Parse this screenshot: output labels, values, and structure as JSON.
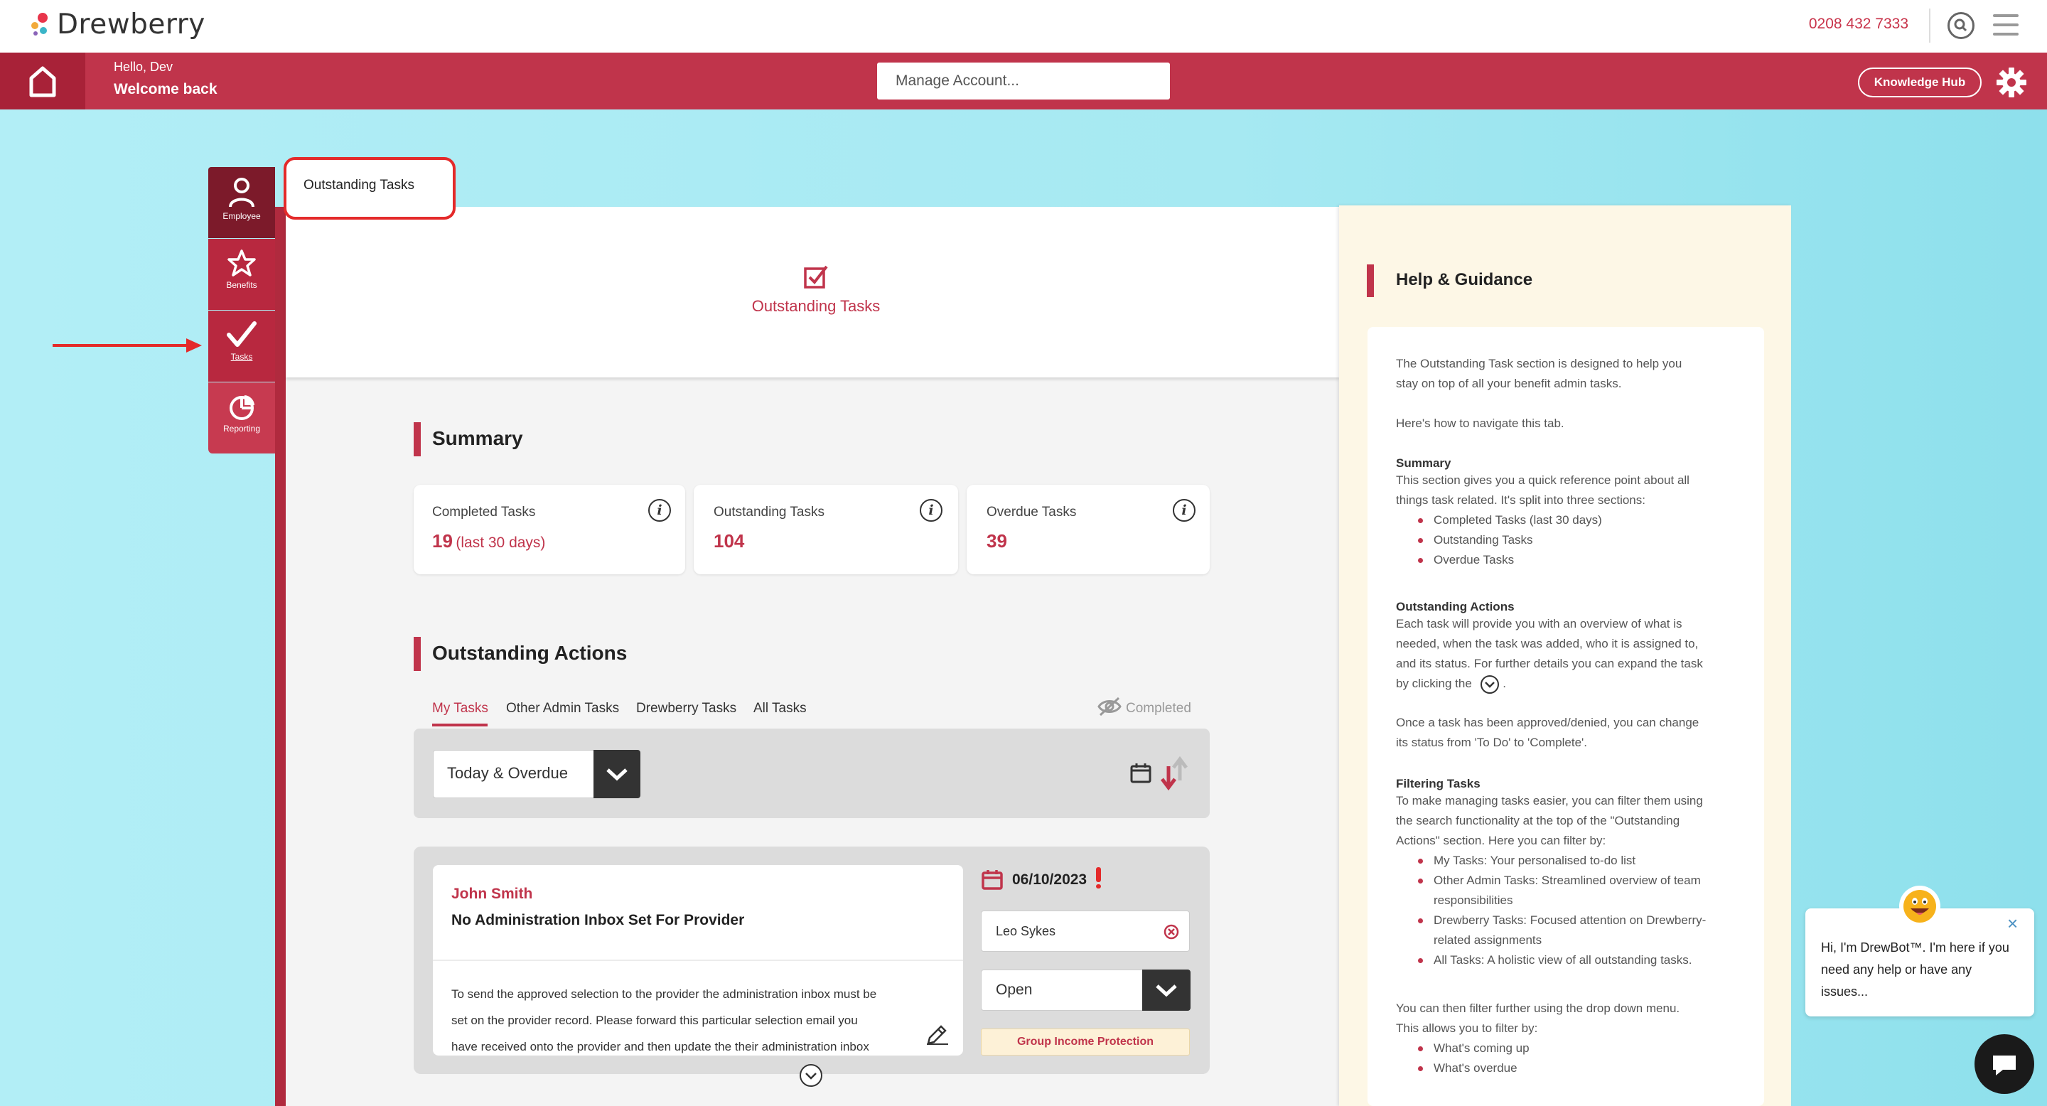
{
  "brand": {
    "name": "Drewberry",
    "accent": "#c0344b",
    "dark_accent": "#7c1a2a"
  },
  "topbar": {
    "phone": "0208 432 7333"
  },
  "header": {
    "greeting": "Hello, Dev",
    "welcome": "Welcome back",
    "manage_placeholder": "Manage Account...",
    "knowledge_hub": "Knowledge Hub"
  },
  "sidebar": {
    "items": [
      {
        "label": "Employee",
        "icon": "person-icon"
      },
      {
        "label": "Benefits",
        "icon": "star-icon"
      },
      {
        "label": "Tasks",
        "icon": "checkmark-icon"
      },
      {
        "label": "Reporting",
        "icon": "pie-chart-icon"
      }
    ]
  },
  "tab": {
    "label": "Outstanding Tasks"
  },
  "hero": {
    "label": "Outstanding Tasks"
  },
  "summary": {
    "title": "Summary",
    "cards": [
      {
        "label": "Completed Tasks",
        "value": "19",
        "suffix": "(last 30 days)"
      },
      {
        "label": "Outstanding Tasks",
        "value": "104",
        "suffix": ""
      },
      {
        "label": "Overdue Tasks",
        "value": "39",
        "suffix": ""
      }
    ]
  },
  "actions": {
    "title": "Outstanding Actions",
    "tabs": [
      "My Tasks",
      "Other Admin Tasks",
      "Drewberry Tasks",
      "All Tasks"
    ],
    "active_tab": "My Tasks",
    "completed_toggle": "Completed",
    "filter_value": "Today & Overdue"
  },
  "task": {
    "name": "John Smith",
    "title": "No Administration Inbox Set For Provider",
    "description": [
      "To send the approved selection to the provider the administration inbox must be",
      "set on the provider record. Please forward this particular selection email you",
      "have received onto the provider and then update the their administration inbox"
    ],
    "date": "06/10/2023",
    "assignee": "Leo Sykes",
    "status": "Open",
    "tag": "Group Income Protection"
  },
  "help": {
    "title": "Help & Guidance",
    "intro": [
      "The Outstanding Task section is designed to help you",
      "stay on top of all your benefit admin tasks."
    ],
    "navigate": "Here's how to navigate this tab.",
    "summary_heading": "Summary",
    "summary_text": [
      "This section gives you a quick reference point about all",
      "things task related. It's split into three sections:"
    ],
    "summary_items": [
      "Completed Tasks (last 30 days)",
      "Outstanding Tasks",
      "Overdue Tasks"
    ],
    "actions_heading": "Outstanding Actions",
    "actions_text": [
      "Each task will provide you with an overview of what is",
      "needed, when the task was added, who it is assigned to,",
      "and its status. For further details you can expand the task",
      "by clicking the"
    ],
    "approved_text": [
      "Once a task has been approved/denied, you can change",
      "its status from 'To Do' to 'Complete'."
    ],
    "filter_heading": "Filtering Tasks",
    "filter_text": [
      "To make managing tasks easier, you can filter them using",
      "the search functionality at the top of the \"Outstanding",
      "Actions\" section. Here you can filter by:"
    ],
    "filter_items": [
      "My Tasks: Your personalised to-do list",
      "Other Admin Tasks: Streamlined overview of team",
      "responsibilities",
      "Drewberry Tasks: Focused attention on Drewberry-",
      "related assignments",
      "All Tasks: A holistic view of all outstanding tasks."
    ],
    "dropdown_text": [
      "You can then filter further using the drop down menu.",
      "This allows you to filter by:"
    ],
    "dropdown_items": [
      "What's coming up",
      "What's overdue"
    ]
  },
  "chat": {
    "lines": [
      "Hi, I'm DrewBot™. I'm here if you",
      "need any help or have any",
      "issues..."
    ]
  }
}
